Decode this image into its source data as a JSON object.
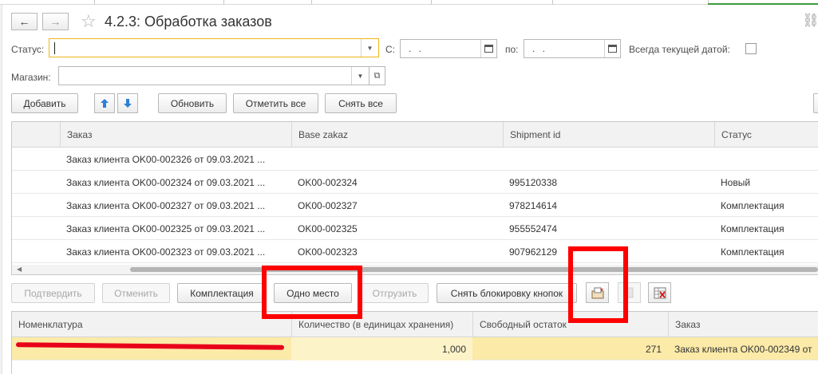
{
  "window": {
    "title": "4.2.3: Обработка заказов",
    "nav_back": "←",
    "nav_forward": "→"
  },
  "filters": {
    "status_label": "Статус:",
    "status_value": "",
    "date_from_label": "С:",
    "date_from_value": ". .",
    "date_to_label": "по:",
    "date_to_value": ". .",
    "always_current_label": "Всегда текущей датой:",
    "always_current_checked": false,
    "shop_label": "Магазин:",
    "shop_value": ""
  },
  "toolbar": {
    "add_label": "Добавить",
    "refresh_label": "Обновить",
    "mark_all_label": "Отметить все",
    "unmark_all_label": "Снять все"
  },
  "orders_table": {
    "columns": [
      "Заказ",
      "Base zakaz",
      "Shipment id",
      "Статус"
    ],
    "rows": [
      {
        "order": "Заказ клиента OK00-002326 от 09.03.2021 ...",
        "base": "",
        "shipment": "",
        "status": ""
      },
      {
        "order": "Заказ клиента OK00-002324 от 09.03.2021 ...",
        "base": "OK00-002324",
        "shipment": "995120338",
        "status": "Новый"
      },
      {
        "order": "Заказ клиента OK00-002327 от 09.03.2021 ...",
        "base": "OK00-002327",
        "shipment": "978214614",
        "status": "Комплектация"
      },
      {
        "order": "Заказ клиента OK00-002325 от 09.03.2021 ...",
        "base": "OK00-002325",
        "shipment": "955552474",
        "status": "Комплектация"
      },
      {
        "order": "Заказ клиента OK00-002323 от 09.03.2021 ...",
        "base": "OK00-002323",
        "shipment": "907962129",
        "status": "Комплектация"
      }
    ]
  },
  "actions": {
    "confirm_label": "Подтвердить",
    "cancel_label": "Отменить",
    "picking_label": "Комплектация",
    "one_place_label": "Одно место",
    "ship_label": "Отгрузить",
    "unlock_label": "Снять блокировку кнопок"
  },
  "items_table": {
    "columns": [
      "Номенклатура",
      "Количество (в единицах хранения)",
      "Свободный остаток",
      "Заказ"
    ],
    "rows": [
      {
        "item": "",
        "qty": "1,000",
        "free": "271",
        "order": "Заказ клиента OK00-002349 от"
      }
    ]
  },
  "colors": {
    "highlight_row": "#fbeaa8",
    "annotation_red": "#ff0000",
    "focus_border": "#f2b41a"
  }
}
